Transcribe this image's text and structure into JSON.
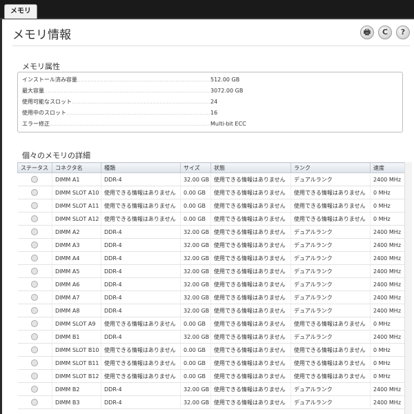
{
  "tab": {
    "label": "メモリ"
  },
  "page": {
    "title": "メモリ情報"
  },
  "toolbar": {
    "print_glyph": "🖶",
    "refresh_glyph": "C",
    "help_glyph": "?"
  },
  "properties": {
    "title": "メモリ属性",
    "rows": [
      {
        "label": "インストール済み容量",
        "value": "512.00 GB"
      },
      {
        "label": "最大容量",
        "value": "3072.00 GB"
      },
      {
        "label": "使用可能なスロット",
        "value": "24"
      },
      {
        "label": "使用中のスロット",
        "value": "16"
      },
      {
        "label": "エラー修正",
        "value": "Multi-bit ECC"
      }
    ]
  },
  "details": {
    "title": "個々のメモリの詳細",
    "columns": [
      "ステータス",
      "コネクタ名",
      "種類",
      "サイズ",
      "状態",
      "ランク",
      "速度"
    ],
    "rows": [
      {
        "name": "DIMM A1",
        "type": "DDR-4",
        "size": "32.00 GB",
        "state": "使用できる情報はありません",
        "rank": "デュアルランク",
        "speed": "2400 MHz"
      },
      {
        "name": "DIMM SLOT A10",
        "type": "使用できる情報はありません",
        "size": "0.00 GB",
        "state": "使用できる情報はありません",
        "rank": "使用できる情報はありません",
        "speed": "0 MHz"
      },
      {
        "name": "DIMM SLOT A11",
        "type": "使用できる情報はありません",
        "size": "0.00 GB",
        "state": "使用できる情報はありません",
        "rank": "使用できる情報はありません",
        "speed": "0 MHz"
      },
      {
        "name": "DIMM SLOT A12",
        "type": "使用できる情報はありません",
        "size": "0.00 GB",
        "state": "使用できる情報はありません",
        "rank": "使用できる情報はありません",
        "speed": "0 MHz"
      },
      {
        "name": "DIMM A2",
        "type": "DDR-4",
        "size": "32.00 GB",
        "state": "使用できる情報はありません",
        "rank": "デュアルランク",
        "speed": "2400 MHz"
      },
      {
        "name": "DIMM A3",
        "type": "DDR-4",
        "size": "32.00 GB",
        "state": "使用できる情報はありません",
        "rank": "デュアルランク",
        "speed": "2400 MHz"
      },
      {
        "name": "DIMM A4",
        "type": "DDR-4",
        "size": "32.00 GB",
        "state": "使用できる情報はありません",
        "rank": "デュアルランク",
        "speed": "2400 MHz"
      },
      {
        "name": "DIMM A5",
        "type": "DDR-4",
        "size": "32.00 GB",
        "state": "使用できる情報はありません",
        "rank": "デュアルランク",
        "speed": "2400 MHz"
      },
      {
        "name": "DIMM A6",
        "type": "DDR-4",
        "size": "32.00 GB",
        "state": "使用できる情報はありません",
        "rank": "デュアルランク",
        "speed": "2400 MHz"
      },
      {
        "name": "DIMM A7",
        "type": "DDR-4",
        "size": "32.00 GB",
        "state": "使用できる情報はありません",
        "rank": "デュアルランク",
        "speed": "2400 MHz"
      },
      {
        "name": "DIMM A8",
        "type": "DDR-4",
        "size": "32.00 GB",
        "state": "使用できる情報はありません",
        "rank": "デュアルランク",
        "speed": "2400 MHz"
      },
      {
        "name": "DIMM SLOT A9",
        "type": "使用できる情報はありません",
        "size": "0.00 GB",
        "state": "使用できる情報はありません",
        "rank": "使用できる情報はありません",
        "speed": "0 MHz"
      },
      {
        "name": "DIMM B1",
        "type": "DDR-4",
        "size": "32.00 GB",
        "state": "使用できる情報はありません",
        "rank": "デュアルランク",
        "speed": "2400 MHz"
      },
      {
        "name": "DIMM SLOT B10",
        "type": "使用できる情報はありません",
        "size": "0.00 GB",
        "state": "使用できる情報はありません",
        "rank": "使用できる情報はありません",
        "speed": "0 MHz"
      },
      {
        "name": "DIMM SLOT B11",
        "type": "使用できる情報はありません",
        "size": "0.00 GB",
        "state": "使用できる情報はありません",
        "rank": "使用できる情報はありません",
        "speed": "0 MHz"
      },
      {
        "name": "DIMM SLOT B12",
        "type": "使用できる情報はありません",
        "size": "0.00 GB",
        "state": "使用できる情報はありません",
        "rank": "使用できる情報はありません",
        "speed": "0 MHz"
      },
      {
        "name": "DIMM B2",
        "type": "DDR-4",
        "size": "32.00 GB",
        "state": "使用できる情報はありません",
        "rank": "デュアルランク",
        "speed": "2400 MHz"
      },
      {
        "name": "DIMM B3",
        "type": "DDR-4",
        "size": "32.00 GB",
        "state": "使用できる情報はありません",
        "rank": "デュアルランク",
        "speed": "2400 MHz"
      }
    ]
  }
}
